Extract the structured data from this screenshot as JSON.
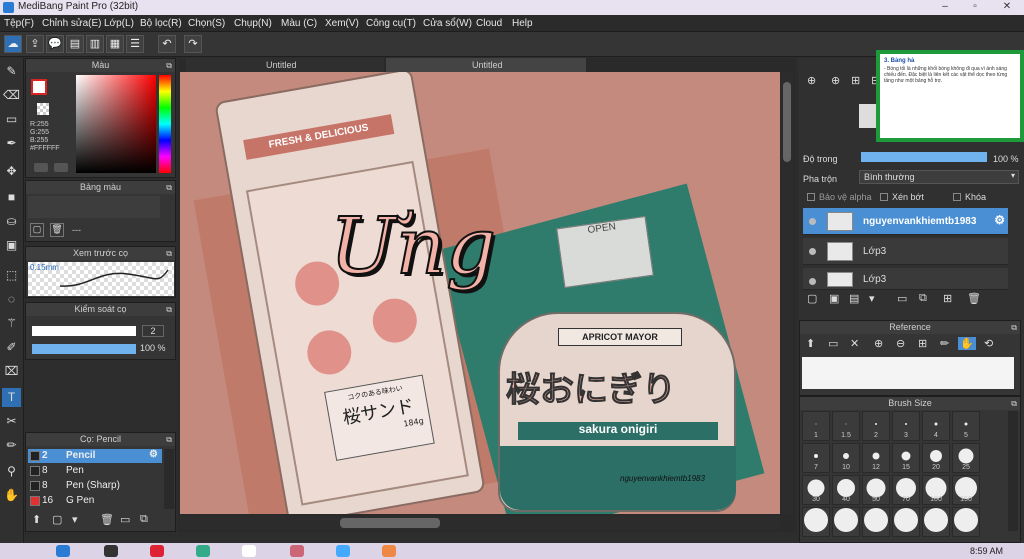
{
  "window": {
    "title": "MediBang Paint Pro (32bit)",
    "minimize": "–",
    "restore": "▫",
    "close": "✕"
  },
  "menu": [
    "Tệp(F)",
    "Chỉnh sửa(E)",
    "Lớp(L)",
    "Bộ lọc(R)",
    "Chọn(S)",
    "Chụp(N)",
    "Màu (C)",
    "Xem(V)",
    "Công cụ(T)",
    "Cửa sổ(W)",
    "Cloud",
    "Help"
  ],
  "tabs": [
    "Untitled",
    "Untitled"
  ],
  "color_panel": {
    "title": "Màu",
    "r": "R:255",
    "g": "G:255",
    "b": "B:255",
    "hex": "#FFFFFF"
  },
  "palette_panel": {
    "title": "Bảng màu",
    "value": "---"
  },
  "preview_panel": {
    "title": "Xem trước cọ",
    "size": "0.15mm"
  },
  "control_panel": {
    "title": "Kiểm soát cọ",
    "size_value": "2",
    "opacity_value": "100 %"
  },
  "brush_panel": {
    "title": "Cọ: Pencil",
    "items": [
      {
        "size": "2",
        "name": "Pencil",
        "selected": true,
        "color": "#222222"
      },
      {
        "size": "8",
        "name": "Pen",
        "color": "#222222"
      },
      {
        "size": "8",
        "name": "Pen (Sharp)",
        "color": "#222222"
      },
      {
        "size": "16",
        "name": "G Pen",
        "color": "#e03030"
      }
    ]
  },
  "artwork": {
    "package_text": "FRESH & DELICIOUS",
    "jp_text1": "コクのある味わい",
    "jp_text2": "桜サンド",
    "weight": "184g",
    "sign": "OPEN",
    "label": "APRICOT MAYOR",
    "jp_big": "桜おにぎり",
    "romaji": "sakura onigiri",
    "overlay_text": "Ưng",
    "signature": "nguyenvankhiemtb1983"
  },
  "layer_panel": {
    "opacity_label": "Độ trong",
    "opacity_value": "100 %",
    "blend_label": "Pha trộn",
    "blend_value": "Bình thường",
    "alpha_label": "Bảo vệ alpha",
    "clip_label": "Xén bớt",
    "lock_label": "Khóa",
    "layers": [
      {
        "name": "nguyenvankhiemtb1983",
        "selected": true
      },
      {
        "name": "Lớp3"
      },
      {
        "name": "Lớp3"
      }
    ]
  },
  "reference_panel": {
    "title": "Reference"
  },
  "brushsize_panel": {
    "title": "Brush Size",
    "sizes": [
      "1",
      "1.5",
      "2",
      "3",
      "4",
      "5",
      "7",
      "10",
      "12",
      "15",
      "20",
      "25",
      "30",
      "40",
      "50",
      "70",
      "100",
      "150"
    ]
  },
  "popup": {
    "heading": "3. Bảng hả",
    "body": "- Bóng tối là những khối bóng không đi qua vì ánh sáng chiếu đến. Đặc biệt là liên kết các vật thể dọc theo từng tầng như một bảng hỗ trợ."
  },
  "clock": "8:59 AM",
  "colors": {
    "accent": "#4a8fd3",
    "selected_layer": "#4a8fd3",
    "popup_border": "#1f9a3a"
  }
}
